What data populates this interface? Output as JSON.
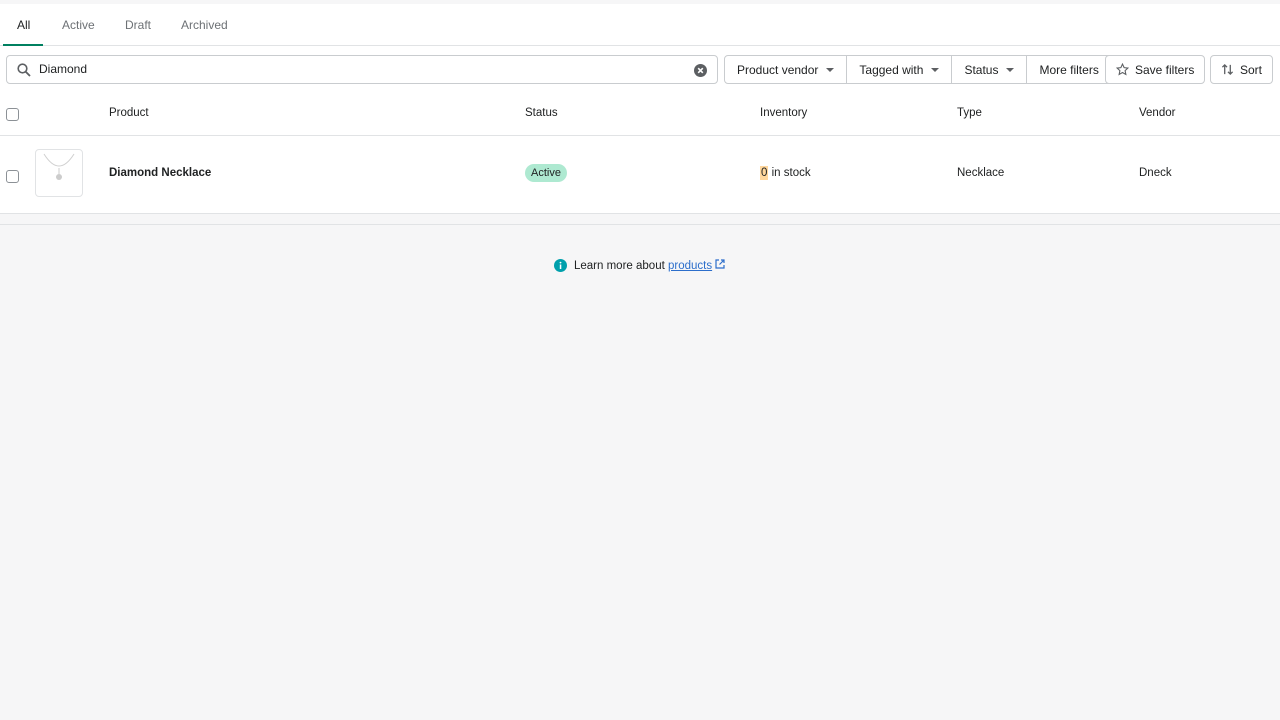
{
  "tabs": [
    {
      "label": "All",
      "selected": true
    },
    {
      "label": "Active"
    },
    {
      "label": "Draft"
    },
    {
      "label": "Archived"
    }
  ],
  "search": {
    "value": "Diamond",
    "placeholder": "Filter products"
  },
  "filters": {
    "product_vendor": "Product vendor",
    "tagged_with": "Tagged with",
    "status": "Status",
    "more_filters": "More filters",
    "save_filters": "Save filters",
    "sort": "Sort"
  },
  "table": {
    "headers": {
      "product": "Product",
      "status": "Status",
      "inventory": "Inventory",
      "type": "Type",
      "vendor": "Vendor"
    },
    "rows": [
      {
        "product": "Diamond Necklace",
        "status": "Active",
        "inventory_count": "0",
        "inventory_suffix": "in stock",
        "type": "Necklace",
        "vendor": "Dneck"
      }
    ]
  },
  "footer": {
    "text": "Learn more about",
    "link": "products"
  },
  "colors": {
    "accent": "#008060",
    "active_badge": "#aee9d1",
    "inventory_zero": "#ffd79d",
    "link": "#2c6ecb",
    "info": "#00a0ac"
  }
}
